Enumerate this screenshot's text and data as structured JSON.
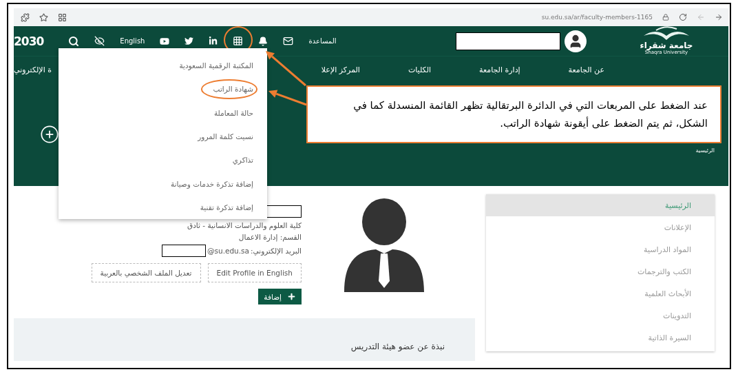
{
  "browser": {
    "url": "su.edu.sa/ar/faculty-members-1165"
  },
  "header": {
    "vision_logo": "2030",
    "language_link": "English",
    "help_link": "المساعدة",
    "apps_circled": true,
    "university_name": "جامعة شقراء",
    "university_name_en": "Shaqra University"
  },
  "nav": {
    "items": [
      "عن الجامعة",
      "إدارة الجامعة",
      "الكليات",
      "المركز الإعلا"
    ],
    "cut_item": "ة الإلكتروني"
  },
  "breadcrumb": "الرئيسية",
  "dropdown": {
    "items": [
      {
        "label": "المكتبة الرقمية السعودية",
        "circled": false
      },
      {
        "label": "شهادة الراتب",
        "circled": true
      },
      {
        "label": "حالة المعاملة",
        "circled": false
      },
      {
        "label": "نسيت كلمة المرور",
        "circled": false
      },
      {
        "label": "تذاكري",
        "circled": false
      },
      {
        "label": "إضافة تذكرة خدمات وصيانة",
        "circled": false
      },
      {
        "label": "إضافة تذكرة تقنية",
        "circled": false
      }
    ]
  },
  "callout": {
    "text": "عند الضغط على المربعات التي في الدائرة البرتقالية تظهر القائمة المنسدلة كما في الشكل، ثم يتم الضغط على أيقونة شهادة الراتب."
  },
  "sidebar": {
    "items": [
      {
        "label": "الرئيسية",
        "selected": true
      },
      {
        "label": "الإعلانات",
        "selected": false
      },
      {
        "label": "المواد الدراسية",
        "selected": false
      },
      {
        "label": "الكتب والترجمات",
        "selected": false
      },
      {
        "label": "الأبحاث العلمية",
        "selected": false
      },
      {
        "label": "التدوينات",
        "selected": false
      },
      {
        "label": "السيرة الذاتية",
        "selected": false
      }
    ]
  },
  "profile": {
    "college": "كلية العلوم والدراسات الانسانية - ثادق",
    "department": "القسم:  إدارة الاعمال",
    "email_label": "البريد الإلكتروني:",
    "email_domain": "@su.edu.sa",
    "buttons": [
      "Edit Profile in English",
      "تعديل الملف الشخصي بالعربية"
    ],
    "add_button": "إضافة"
  },
  "about": {
    "title": "نبذة عن عضو هيئة التدريس"
  }
}
